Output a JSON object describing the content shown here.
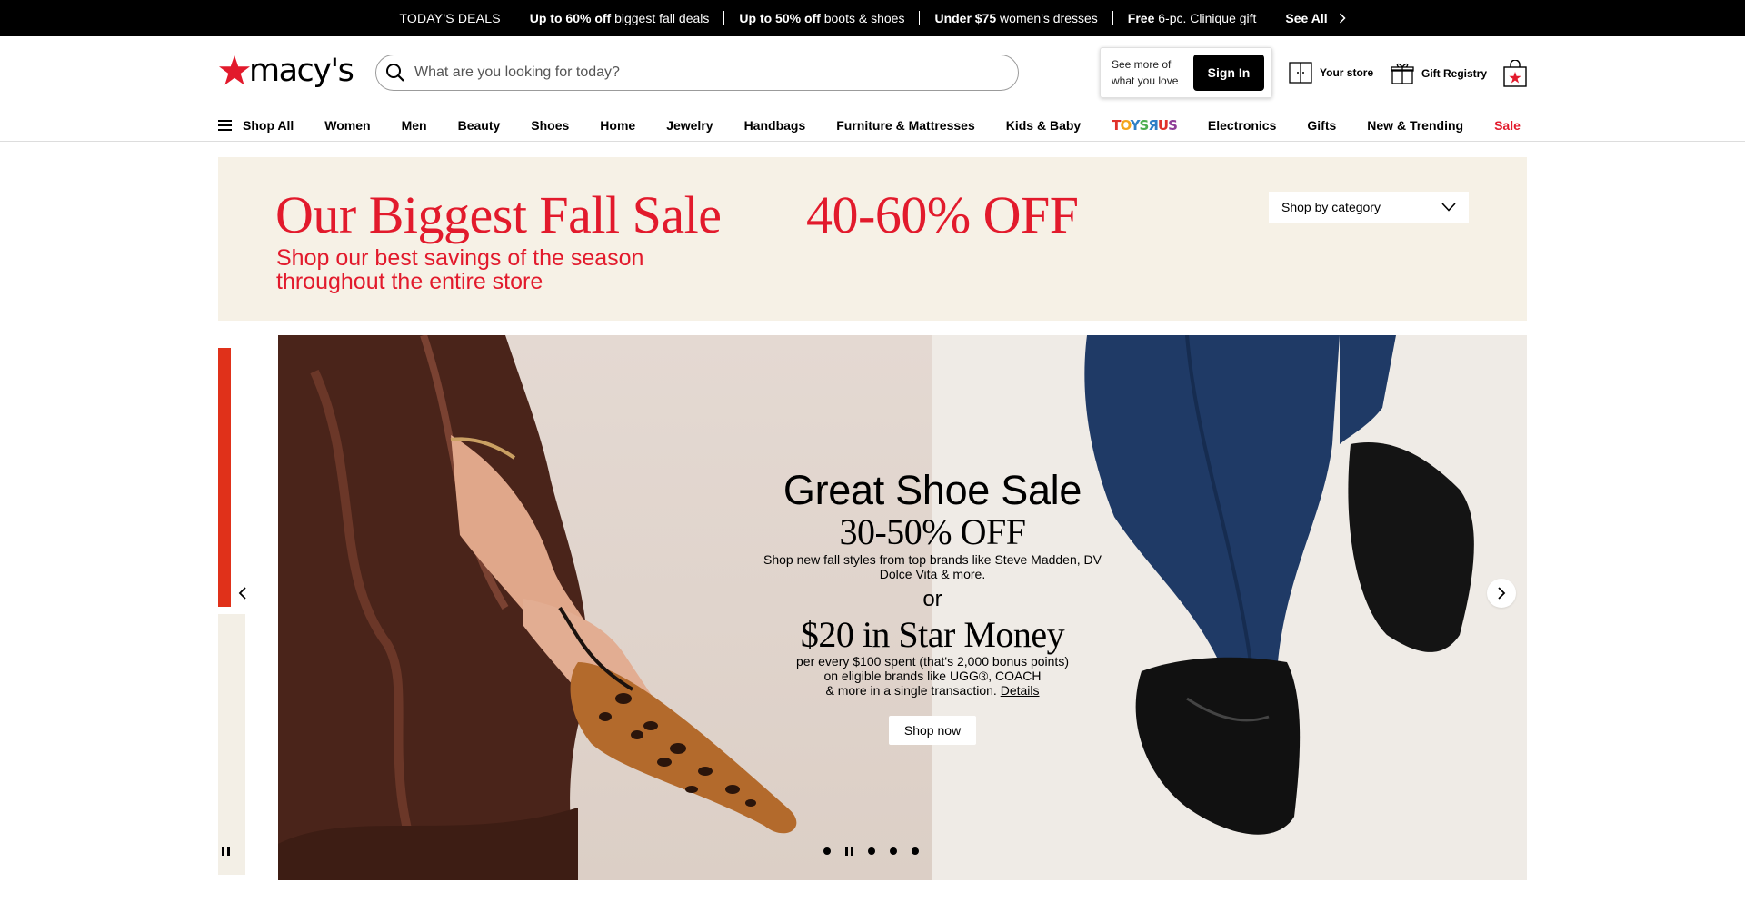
{
  "deals_bar": {
    "today_label": "TODAY'S DEALS",
    "deals": [
      {
        "bold": "Up to 60% off",
        "text": " biggest fall deals"
      },
      {
        "bold": "Up to 50% off",
        "text": " boots & shoes"
      },
      {
        "bold": "Under $75",
        "text": " women's dresses"
      },
      {
        "bold": "Free",
        "text": " 6-pc. Clinique gift"
      }
    ],
    "see_all": "See All"
  },
  "header": {
    "logo_text": "macy's",
    "search_placeholder": "What are you looking for today?",
    "signin_prompt": "See more of what you love",
    "signin_label": "Sign In",
    "store_label": "Your store",
    "registry_label": "Gift Registry"
  },
  "nav": {
    "shop_all": "Shop All",
    "items": [
      "Women",
      "Men",
      "Beauty",
      "Shoes",
      "Home",
      "Jewelry",
      "Handbags",
      "Furniture & Mattresses",
      "Kids & Baby"
    ],
    "toys_logo": "TOYSЯUS",
    "items2": [
      "Electronics",
      "Gifts",
      "New & Trending"
    ],
    "sale": "Sale"
  },
  "sale_banner": {
    "title": "Our Biggest Fall Sale",
    "discount": "40-60% OFF",
    "subtitle": "Shop our best savings of the season throughout the entire store",
    "category_dropdown": "Shop by category"
  },
  "hero": {
    "title": "Great Shoe Sale",
    "discount": "30-50% OFF",
    "description": "Shop new fall styles from top brands like Steve Madden, DV Dolce Vita & more.",
    "or_text": "or",
    "star_money": "$20 in Star Money",
    "fine_print_1": "per every $100 spent (that's 2,000 bonus points)",
    "fine_print_2": "on eligible brands like UGG®, COACH",
    "fine_print_3": "& more in a single transaction. ",
    "details_link": "Details",
    "cta": "Shop now",
    "slide_count": 5,
    "active_slide": 2
  },
  "colors": {
    "brand_red": "#e21a2c",
    "banner_bg": "#f6f1e6",
    "deals_bar_bg": "#000000"
  }
}
